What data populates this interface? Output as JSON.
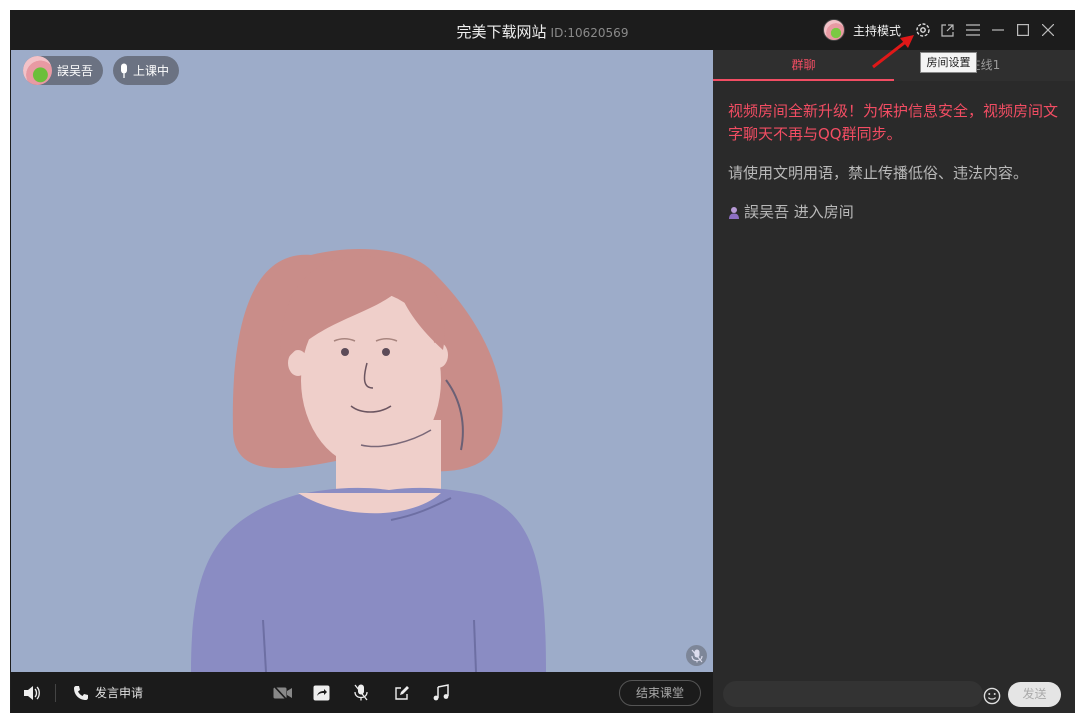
{
  "window": {
    "title": "完美下载网站",
    "room_id": "ID:10620569",
    "host_mode_label": "主持模式",
    "tooltip": "房间设置"
  },
  "video": {
    "user_name": "誤吴吾",
    "class_status": "上课中"
  },
  "bottombar": {
    "speak_request_label": "发言申请",
    "end_class_label": "结束课堂"
  },
  "chat": {
    "tabs": [
      {
        "label": "群聊"
      },
      {
        "label": "在线1"
      }
    ],
    "messages": {
      "warning": "视频房间全新升级！为保护信息安全，视频房间文字聊天不再与QQ群同步。",
      "notice": "请使用文明用语，禁止传播低俗、违法内容。",
      "join_user": "誤吴吾",
      "join_text": "进入房间"
    },
    "send_label": "发送"
  },
  "colors": {
    "accent": "#f24d63",
    "video_bg": "#9dacc9",
    "panel_bg": "#2a2a2a"
  }
}
